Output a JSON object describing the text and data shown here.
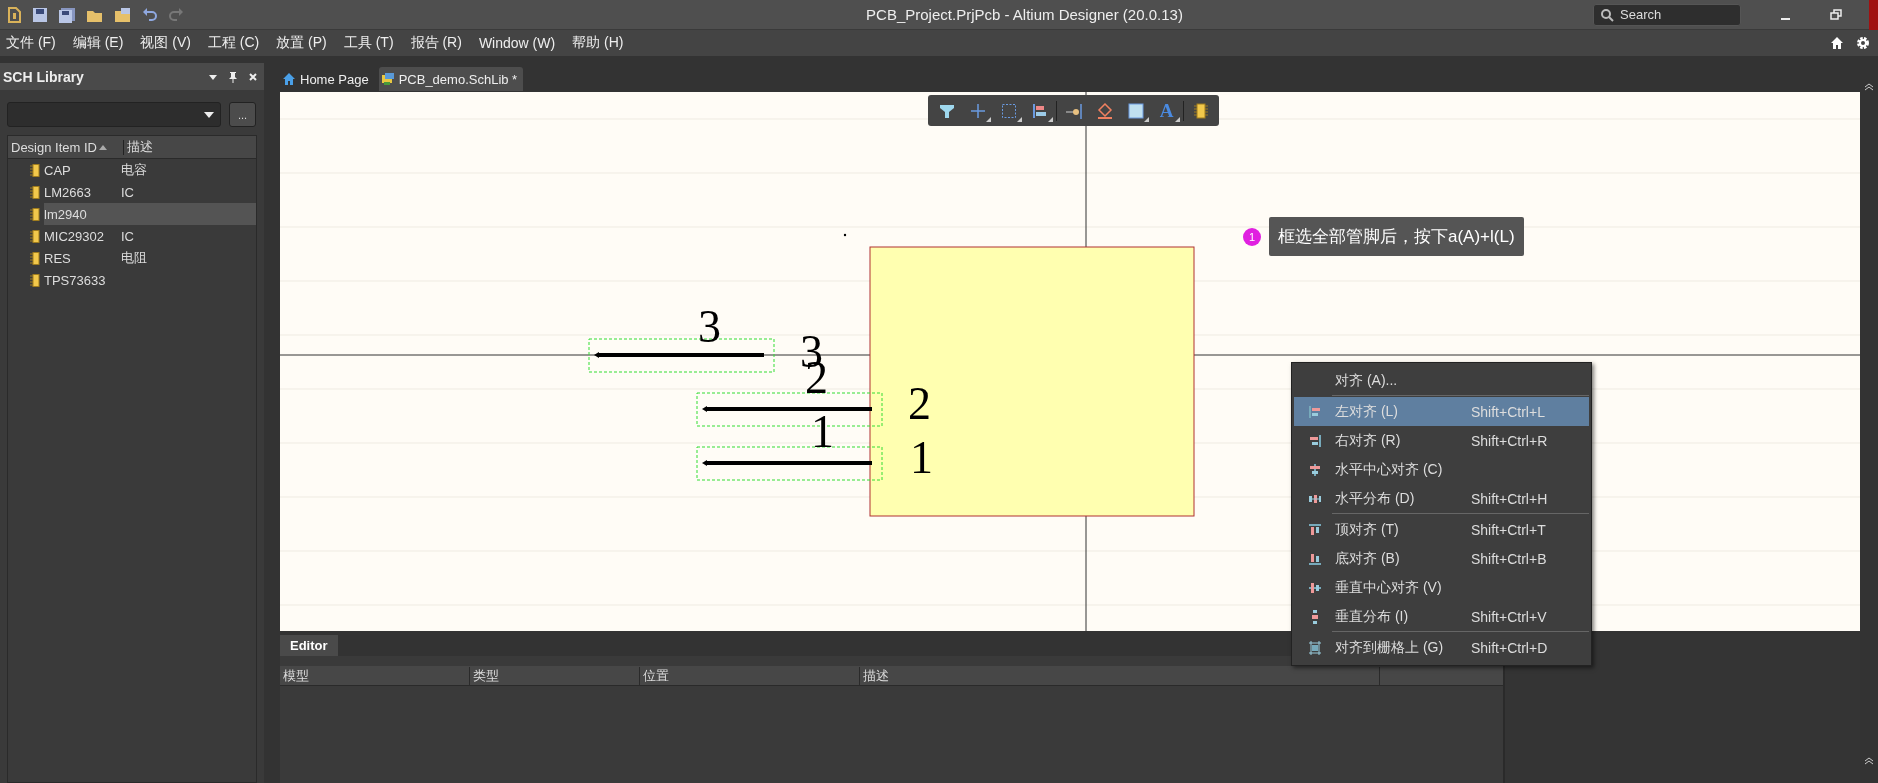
{
  "window": {
    "title": "PCB_Project.PrjPcb - Altium Designer (20.0.13)",
    "search_placeholder": "Search"
  },
  "menu": [
    "文件 (F)",
    "编辑 (E)",
    "视图 (V)",
    "工程 (C)",
    "放置 (P)",
    "工具 (T)",
    "报告 (R)",
    "Window (W)",
    "帮助 (H)"
  ],
  "panel": {
    "title": "SCH Library",
    "browse_button": "...",
    "columns": [
      "Design Item ID",
      "描述"
    ],
    "items": [
      {
        "id": "CAP",
        "description": "电容",
        "selected": false
      },
      {
        "id": "LM2663",
        "description": "IC",
        "selected": false
      },
      {
        "id": "lm2940",
        "selected": true
      },
      {
        "id": "MIC29302",
        "description": "IC",
        "selected": false
      },
      {
        "id": "RES",
        "description": "电阻",
        "selected": false
      },
      {
        "id": "TPS73633",
        "selected": false
      }
    ]
  },
  "tabs": [
    {
      "label": "Home Page",
      "kind": "home",
      "selected": false
    },
    {
      "label": "PCB_demo.SchLib *",
      "kind": "schlib",
      "selected": true
    }
  ],
  "toolbar": [
    {
      "kind": "filter"
    },
    {
      "kind": "cross",
      "dropdown": true
    },
    {
      "kind": "select",
      "dropdown": true
    },
    {
      "kind": "align",
      "dropdown": true
    },
    {
      "kind": "pin"
    },
    {
      "kind": "fill"
    },
    {
      "kind": "rect",
      "dropdown": true
    },
    {
      "kind": "text",
      "label": "A",
      "dropdown": true
    },
    {
      "kind": "part"
    }
  ],
  "pins": [
    {
      "designator": "3",
      "name": "3",
      "selected": true
    },
    {
      "designator": "2",
      "name": "2",
      "selected": true
    },
    {
      "designator": "1",
      "name": "1",
      "selected": true
    }
  ],
  "callout": {
    "number": "1",
    "text": "框选全部管脚后，按下a(A)+l(L)"
  },
  "context_menu": [
    {
      "label": "对齐 (A)...",
      "selected": false,
      "separator_after": true
    },
    {
      "label": "左对齐 (L)",
      "shortcut": "Shift+Ctrl+L",
      "selected": true
    },
    {
      "label": "右对齐 (R)",
      "shortcut": "Shift+Ctrl+R",
      "selected": false
    },
    {
      "label": "水平中心对齐 (C)",
      "selected": false
    },
    {
      "label": "水平分布 (D)",
      "shortcut": "Shift+Ctrl+H",
      "selected": false,
      "separator_after": true
    },
    {
      "label": "顶对齐 (T)",
      "shortcut": "Shift+Ctrl+T",
      "selected": false
    },
    {
      "label": "底对齐 (B)",
      "shortcut": "Shift+Ctrl+B",
      "selected": false
    },
    {
      "label": "垂直中心对齐 (V)",
      "selected": false
    },
    {
      "label": "垂直分布 (I)",
      "shortcut": "Shift+Ctrl+V",
      "selected": false,
      "separator_after": true
    },
    {
      "label": "对齐到栅格上 (G)",
      "shortcut": "Shift+Ctrl+D",
      "selected": false
    }
  ],
  "editor": {
    "tab": "Editor",
    "columns": [
      "模型",
      "类型",
      "位置",
      "描述"
    ]
  }
}
